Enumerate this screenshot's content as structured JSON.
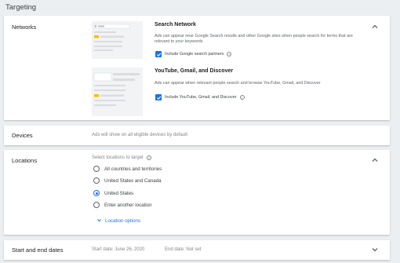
{
  "page": {
    "title": "Targeting"
  },
  "networks": {
    "label": "Networks",
    "search": {
      "title": "Search Network",
      "description": "Ads can appear near Google Search results and other Google sites when people search for terms that are relevant to your keywords",
      "checkbox_label": "Include Google search partners",
      "checked": true
    },
    "display": {
      "title": "YouTube, Gmail, and Discover",
      "description": "Ads can appear when relevant people search and browse YouTube, Gmail, and Discover",
      "checkbox_label": "Include YouTube, Gmail, and Discover",
      "checked": true
    }
  },
  "devices": {
    "label": "Devices",
    "value": "Ads will show on all eligible devices by default"
  },
  "locations": {
    "label": "Locations",
    "prompt": "Select locations to target",
    "options": [
      {
        "label": "All countries and territories",
        "selected": false
      },
      {
        "label": "United States and Canada",
        "selected": false
      },
      {
        "label": "United States",
        "selected": true
      },
      {
        "label": "Enter another location",
        "selected": false
      }
    ],
    "more_link": "Location options"
  },
  "dates": {
    "label": "Start and end dates",
    "start": "Start date: June 26, 2020",
    "end": "End date: Not set"
  },
  "colors": {
    "accent": "#1a73e8",
    "background": "#eceff1",
    "card": "#ffffff",
    "muted": "#80868b",
    "thumb_highlight": "#fbbc04"
  },
  "icons": [
    "chevron-up-icon",
    "chevron-down-icon",
    "help-icon",
    "checkbox-checked-icon",
    "radio-icon"
  ]
}
